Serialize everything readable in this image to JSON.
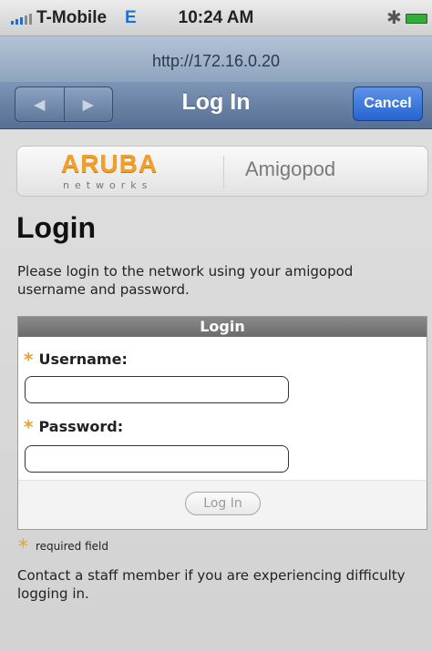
{
  "status_bar": {
    "carrier": "T-Mobile",
    "network": "E",
    "time": "10:24 AM",
    "bluetooth_icon": "bluetooth-icon",
    "battery_icon": "battery-icon",
    "signal_icon": "signal-bars-icon"
  },
  "browser": {
    "url": "http://172.16.0.20",
    "title": "Log In",
    "cancel_label": "Cancel",
    "back_icon": "◀",
    "forward_icon": "▶"
  },
  "logo": {
    "brand": "ARUBA",
    "brand_sub": "networks",
    "product": "Amigopod",
    "brand_color": "#f0a02a"
  },
  "page": {
    "title": "Login",
    "intro": "Please login to the network using your amigopod username and password.",
    "form": {
      "header": "Login",
      "required_marker": "*",
      "username_label": "Username:",
      "username_value": "",
      "password_label": "Password:",
      "password_value": "",
      "submit_label": "Log In"
    },
    "required_note": "required field",
    "contact_note": "Contact a staff member if you are experiencing difficulty logging in."
  }
}
